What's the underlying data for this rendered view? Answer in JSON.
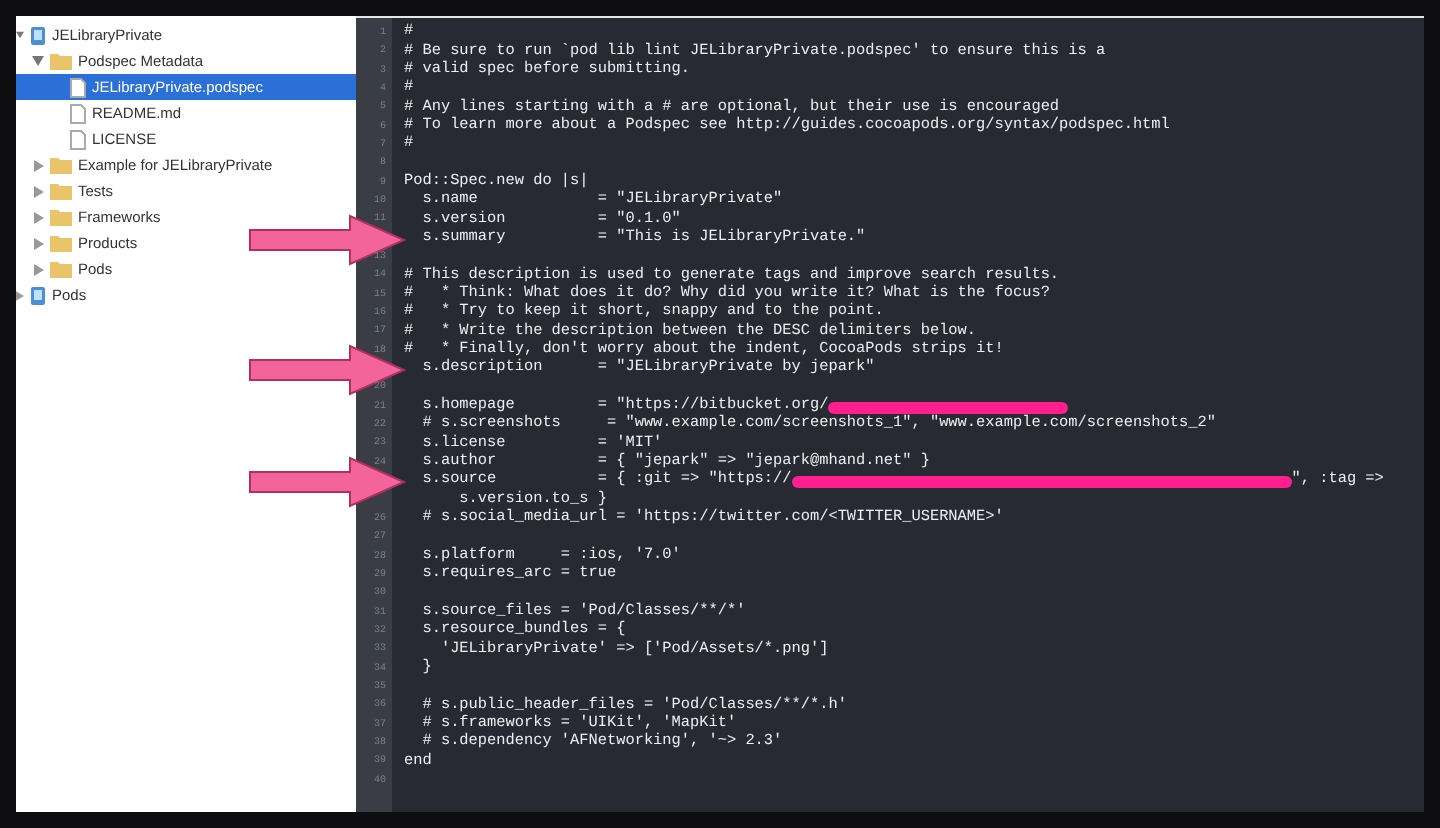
{
  "navigator": {
    "items": [
      {
        "label": "JELibraryPrivate",
        "kind": "project",
        "expanded": true,
        "selected": false,
        "children": [
          {
            "label": "Podspec Metadata",
            "kind": "folder",
            "expanded": true,
            "selected": false,
            "children": [
              {
                "label": "JELibraryPrivate.podspec",
                "kind": "file",
                "selected": true
              },
              {
                "label": "README.md",
                "kind": "file",
                "selected": false
              },
              {
                "label": "LICENSE",
                "kind": "file",
                "selected": false
              }
            ]
          },
          {
            "label": "Example for JELibraryPrivate",
            "kind": "folder",
            "expanded": false,
            "selected": false
          },
          {
            "label": "Tests",
            "kind": "folder",
            "expanded": false,
            "selected": false
          },
          {
            "label": "Frameworks",
            "kind": "folder",
            "expanded": false,
            "selected": false
          },
          {
            "label": "Products",
            "kind": "folder",
            "expanded": false,
            "selected": false
          },
          {
            "label": "Pods",
            "kind": "folder",
            "expanded": false,
            "selected": false
          }
        ]
      },
      {
        "label": "Pods",
        "kind": "project",
        "expanded": false,
        "selected": false
      }
    ]
  },
  "editor": {
    "lines": [
      {
        "number": "1",
        "text": "#"
      },
      {
        "number": "2",
        "text": "# Be sure to run `pod lib lint JELibraryPrivate.podspec' to ensure this is a"
      },
      {
        "number": "3",
        "text": "# valid spec before submitting."
      },
      {
        "number": "4",
        "text": "#"
      },
      {
        "number": "5",
        "text": "# Any lines starting with a # are optional, but their use is encouraged"
      },
      {
        "number": "6",
        "text": "# To learn more about a Podspec see http://guides.cocoapods.org/syntax/podspec.html"
      },
      {
        "number": "7",
        "text": "#"
      },
      {
        "number": "8"
      },
      {
        "number": "9",
        "text": "Pod::Spec.new do |s|"
      },
      {
        "number": "10",
        "text": "  s.name             = \"JELibraryPrivate\""
      },
      {
        "number": "11",
        "text": "  s.version          = \"0.1.0\""
      },
      {
        "text": "  s.summary          = \"This is JELibraryPrivate.\"",
        "pointer": true
      },
      {
        "number": "13"
      },
      {
        "number": "14",
        "text": "# This description is used to generate tags and improve search results."
      },
      {
        "number": "15",
        "text": "#   * Think: What does it do? Why did you write it? What is the focus?"
      },
      {
        "number": "16",
        "text": "#   * Try to keep it short, snappy and to the point."
      },
      {
        "number": "17",
        "text": "#   * Write the description between the DESC delimiters below."
      },
      {
        "number": "18",
        "text": "#   * Finally, don't worry about the indent, CocoaPods strips it!"
      },
      {
        "text": "  s.description      = \"JELibraryPrivate by jepark\"",
        "pointer": true
      },
      {
        "number": "20"
      },
      {
        "number": "21",
        "text": "  s.homepage         = \"https://bitbucket.org/",
        "redacted": true
      },
      {
        "number": "22",
        "text": "  # s.screenshots     = \"www.example.com/screenshots_1\", \"www.example.com/screenshots_2\""
      },
      {
        "number": "23",
        "text": "  s.license          = 'MIT'"
      },
      {
        "number": "24",
        "text": "  s.author           = { \"jepark\" => \"jepark@mhand.net\" }"
      },
      {
        "text": "  s.source           = { :git => \"https://",
        "redacted": true,
        "after": "\", :tag =>",
        "pointer": true
      },
      {
        "text": "      s.version.to_s }"
      },
      {
        "number": "26",
        "text": "  # s.social_media_url = 'https://twitter.com/<TWITTER_USERNAME>'"
      },
      {
        "number": "27"
      },
      {
        "number": "28",
        "text": "  s.platform     = :ios, '7.0'"
      },
      {
        "number": "29",
        "text": "  s.requires_arc = true"
      },
      {
        "number": "30"
      },
      {
        "number": "31",
        "text": "  s.source_files = 'Pod/Classes/**/*'"
      },
      {
        "number": "32",
        "text": "  s.resource_bundles = {"
      },
      {
        "number": "33",
        "text": "    'JELibraryPrivate' => ['Pod/Assets/*.png']"
      },
      {
        "number": "34",
        "text": "  }"
      },
      {
        "number": "35"
      },
      {
        "number": "36",
        "text": "  # s.public_header_files = 'Pod/Classes/**/*.h'"
      },
      {
        "number": "37",
        "text": "  # s.frameworks = 'UIKit', 'MapKit'"
      },
      {
        "number": "38",
        "text": "  # s.dependency 'AFNetworking', '~> 2.3'"
      },
      {
        "number": "39",
        "text": "end"
      },
      {
        "number": "40"
      }
    ]
  }
}
